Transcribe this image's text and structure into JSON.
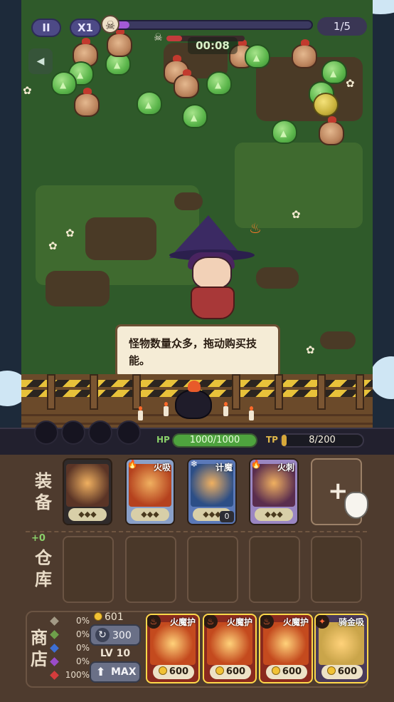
{
  "hud": {
    "pause_icon": "pause-icon",
    "pause_glyph": "II",
    "speed_label": "X1",
    "wave_count": "1/5",
    "wave_progress": 0.1,
    "boss_progress": 0.2,
    "timer": "00:08",
    "skull_glyph": "☠",
    "back_glyph": "◀"
  },
  "tooltip": {
    "text": "怪物数量众多，拖动购买技能。"
  },
  "status": {
    "hp_label": "HP",
    "hp_text": "1000/1000",
    "hp_fraction": 1.0,
    "tp_label": "TP",
    "tp_text": "8/200",
    "tp_fraction": 0.04
  },
  "equipment": {
    "label": "装备",
    "cards": [
      {
        "name": "",
        "stars": "◆◆◆",
        "element_icon": "fire-icon",
        "element_glyph": "",
        "color": "#2f2a2a",
        "art": "#5a3426",
        "stack": ""
      },
      {
        "name": "火吸",
        "stars": "◆◆◆",
        "element_icon": "fire-icon",
        "element_glyph": "🔥",
        "color": "#8aa0c8",
        "art": "#b5421e",
        "stack": ""
      },
      {
        "name": "计魔",
        "stars": "◆◆◆",
        "element_icon": "ice-icon",
        "element_glyph": "❄",
        "color": "#5b79b8",
        "art": "#2c4e86",
        "stack": "0"
      },
      {
        "name": "火刺",
        "stars": "◆◆◆",
        "element_icon": "fire-icon",
        "element_glyph": "🔥",
        "color": "#9a86c2",
        "art": "#5a2d4e",
        "stack": ""
      }
    ],
    "add_glyph": "+"
  },
  "warehouse": {
    "label": "仓库",
    "delta": "+0"
  },
  "shop": {
    "label": "商店",
    "odds": [
      {
        "color": "#a39a86",
        "value": "0%"
      },
      {
        "color": "#6ea04a",
        "value": "0%"
      },
      {
        "color": "#3d6fd4",
        "value": "0%"
      },
      {
        "color": "#9a4cc8",
        "value": "0%"
      },
      {
        "color": "#d43c3c",
        "value": "100%"
      }
    ],
    "gold": "601",
    "refresh_cost": "300",
    "level": "LV 10",
    "max_label": "MAX",
    "cards": [
      {
        "name": "火魔护",
        "price": "600",
        "art": "#c44a1e",
        "bg": "#8a2a1e"
      },
      {
        "name": "火魔护",
        "price": "600",
        "art": "#c44a1e",
        "bg": "#8a2a1e"
      },
      {
        "name": "火魔护",
        "price": "600",
        "art": "#c44a1e",
        "bg": "#8a2a1e"
      },
      {
        "name": "骑金吸",
        "price": "600",
        "art": "#caa54a",
        "bg": "#4a3a5a"
      }
    ]
  }
}
